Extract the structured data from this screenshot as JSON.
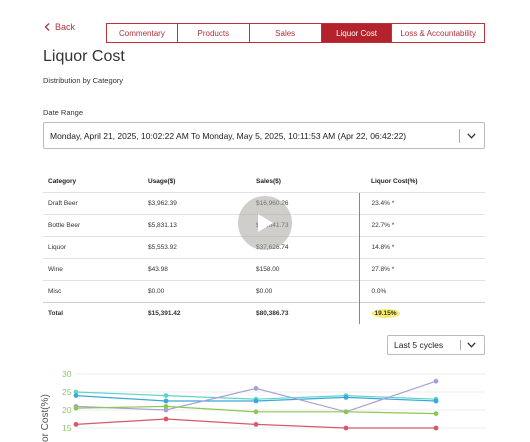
{
  "nav": {
    "back_label": "Back",
    "tabs": [
      {
        "label": "Commentary",
        "active": false
      },
      {
        "label": "Products",
        "active": false
      },
      {
        "label": "Sales",
        "active": false
      },
      {
        "label": "Liquor Cost",
        "active": true
      },
      {
        "label": "Loss & Accountability",
        "active": false
      }
    ]
  },
  "page": {
    "title": "Liquor Cost",
    "subtitle": "Distribution by Category"
  },
  "date_range": {
    "label": "Date Range",
    "value": "Monday, April 21, 2025, 10:02:22 AM To Monday, May 5, 2025, 10:11:53 AM (Apr 22, 06:42:22)"
  },
  "table": {
    "headers": [
      "Category",
      "Usage($)",
      "Sales($)",
      "Liquor Cost(%)"
    ],
    "rows": [
      {
        "category": "Draft Beer",
        "usage": "$3,962.39",
        "sales": "$16,960.26",
        "cost": "23.4% *"
      },
      {
        "category": "Bottle Beer",
        "usage": "$5,831.13",
        "sales": "$25,641.73",
        "cost": "22.7% *"
      },
      {
        "category": "Liquor",
        "usage": "$5,553.92",
        "sales": "$37,626.74",
        "cost": "14.8% *"
      },
      {
        "category": "Wine",
        "usage": "$43.98",
        "sales": "$158.00",
        "cost": "27.8% *"
      },
      {
        "category": "Misc",
        "usage": "$0.00",
        "sales": "$0.00",
        "cost": "0.0%"
      }
    ],
    "total": {
      "category": "Total",
      "usage": "$15,391.42",
      "sales": "$80,386.73",
      "cost": "19.15%"
    }
  },
  "cycles_select": {
    "value": "Last 5 cycles"
  },
  "chart_data": {
    "type": "line",
    "ylabel": "or Cost(%)",
    "ylim": [
      15,
      30
    ],
    "yticks": [
      "30",
      "25",
      "20",
      "15"
    ],
    "x": [
      1,
      2,
      3,
      4,
      5
    ],
    "series": [
      {
        "color": "#5fd4cc",
        "values": [
          25,
          24,
          23,
          24,
          23
        ]
      },
      {
        "color": "#3aa8d8",
        "values": [
          24,
          22.5,
          22.5,
          23.5,
          22.5
        ]
      },
      {
        "color": "#aaa0d8",
        "values": [
          21,
          20,
          26,
          19.5,
          28
        ]
      },
      {
        "color": "#8cc850",
        "values": [
          20.5,
          21,
          19.5,
          19.5,
          19
        ]
      },
      {
        "color": "#d85868",
        "values": [
          16,
          17.5,
          16,
          15,
          15
        ]
      }
    ]
  }
}
